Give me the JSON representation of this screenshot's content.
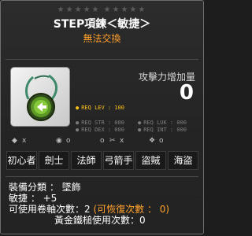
{
  "stars": [
    "★",
    "★",
    "★",
    "★",
    "★",
    "★",
    "★",
    "★",
    "★",
    "★"
  ],
  "item": {
    "name": "STEP項鍊＜敏捷＞",
    "trade_status": "無法交換",
    "icon": "green-pendant-with-left-arrow-icon"
  },
  "attack": {
    "label": "攻擊力增加量",
    "value": "0"
  },
  "requirements": {
    "level": "REQ LEV : 100",
    "str": "REQ STR : 000",
    "luk": "REQ LUK : 000",
    "dex": "REQ DEX : 000",
    "int": "REQ INT : 000"
  },
  "status_row": {
    "items": [
      {
        "icon": "gem-icon",
        "value": "x"
      },
      {
        "icon": "potential-icon",
        "value": "o"
      },
      {
        "icon": "blank-icon",
        "value": "o"
      },
      {
        "icon": "scissors-icon",
        "value": "x"
      },
      {
        "icon": "bonus-icon",
        "value": "o"
      }
    ]
  },
  "jobs": [
    "初心者",
    "劍士",
    "法師",
    "弓箭手",
    "盜賊",
    "海盜"
  ],
  "stats": {
    "category": "裝備分類 ： 墜飾",
    "dex": "敏捷 ： +5",
    "upgrades_prefix": "可使用卷軸次數：2 ",
    "upgrades_restore": "(可恢復次數 ： 0)",
    "hammer": "黃金鐵槌使用次數：0"
  },
  "colors": {
    "background": "#242424",
    "title": "#ffffff",
    "trade_status": "#ffa02b",
    "req_level": "#ffc21a",
    "req_other": "#7d7d7d"
  }
}
